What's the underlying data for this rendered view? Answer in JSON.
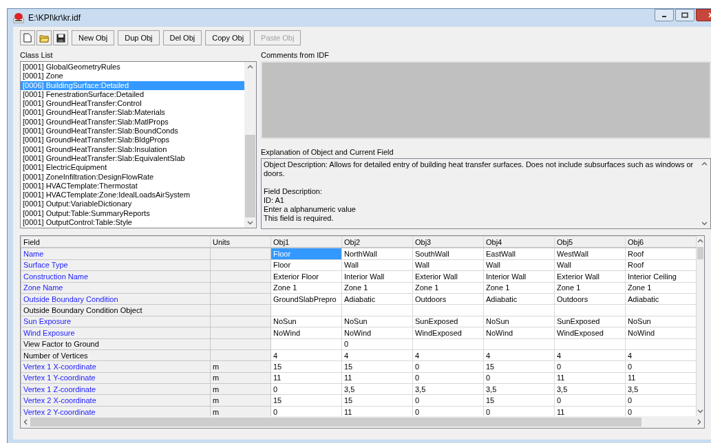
{
  "window": {
    "title": "E:\\KPI\\kr\\kr.idf"
  },
  "toolbar": {
    "buttons": [
      {
        "label": "New Obj",
        "disabled": false
      },
      {
        "label": "Dup Obj",
        "disabled": false
      },
      {
        "label": "Del Obj",
        "disabled": false
      },
      {
        "label": "Copy Obj",
        "disabled": false
      },
      {
        "label": "Paste Obj",
        "disabled": true
      }
    ]
  },
  "class_list": {
    "label": "Class List",
    "items": [
      {
        "text": "[0001]  GlobalGeometryRules",
        "selected": false
      },
      {
        "text": "[0001]  Zone",
        "selected": false
      },
      {
        "text": "[0006]  BuildingSurface:Detailed",
        "selected": true
      },
      {
        "text": "[0001]  FenestrationSurface:Detailed",
        "selected": false
      },
      {
        "text": "[0001]  GroundHeatTransfer:Control",
        "selected": false
      },
      {
        "text": "[0001]  GroundHeatTransfer:Slab:Materials",
        "selected": false
      },
      {
        "text": "[0001]  GroundHeatTransfer:Slab:MatlProps",
        "selected": false
      },
      {
        "text": "[0001]  GroundHeatTransfer:Slab:BoundConds",
        "selected": false
      },
      {
        "text": "[0001]  GroundHeatTransfer:Slab:BldgProps",
        "selected": false
      },
      {
        "text": "[0001]  GroundHeatTransfer:Slab:Insulation",
        "selected": false
      },
      {
        "text": "[0001]  GroundHeatTransfer:Slab:EquivalentSlab",
        "selected": false
      },
      {
        "text": "[0001]  ElectricEquipment",
        "selected": false
      },
      {
        "text": "[0001]  ZoneInfiltration:DesignFlowRate",
        "selected": false
      },
      {
        "text": "[0001]  HVACTemplate:Thermostat",
        "selected": false
      },
      {
        "text": "[0001]  HVACTemplate:Zone:IdealLoadsAirSystem",
        "selected": false
      },
      {
        "text": "[0001]  Output:VariableDictionary",
        "selected": false
      },
      {
        "text": "[0001]  Output:Table:SummaryReports",
        "selected": false
      },
      {
        "text": "[0001]  OutputControl:Table:Style",
        "selected": false
      }
    ]
  },
  "comments": {
    "label": "Comments from IDF"
  },
  "explanation": {
    "label": "Explanation of Object and Current Field",
    "lines": [
      "Object Description: Allows for detailed entry of building heat transfer surfaces.  Does not include subsurfaces such as windows or doors.",
      "Field Description:",
      "ID: A1",
      "Enter a alphanumeric value",
      "This field is required."
    ]
  },
  "grid": {
    "field_header": "Field",
    "units_header": "Units",
    "columns": [
      "Obj1",
      "Obj2",
      "Obj3",
      "Obj4",
      "Obj5",
      "Obj6"
    ],
    "rows": [
      {
        "field": "Name",
        "required": true,
        "cells": [
          {
            "text": "Floor",
            "selected": true
          },
          {
            "text": "NorthWall",
            "selected": false
          },
          {
            "text": "SouthWall",
            "selected": false
          },
          {
            "text": "EastWall",
            "selected": false
          },
          {
            "text": "WestWall",
            "selected": false
          },
          {
            "text": "Roof",
            "selected": false
          }
        ]
      },
      {
        "field": "Surface Type",
        "required": true,
        "cells": [
          {
            "text": "Floor",
            "selected": false
          },
          {
            "text": "Wall",
            "selected": false
          },
          {
            "text": "Wall",
            "selected": false
          },
          {
            "text": "Wall",
            "selected": false
          },
          {
            "text": "Wall",
            "selected": false
          },
          {
            "text": "Roof",
            "selected": false
          }
        ]
      },
      {
        "field": "Construction Name",
        "required": true,
        "cells": [
          {
            "text": "Exterior Floor",
            "selected": false
          },
          {
            "text": "Interior Wall",
            "selected": false
          },
          {
            "text": "Exterior Wall",
            "selected": false
          },
          {
            "text": "Interior Wall",
            "selected": false
          },
          {
            "text": "Exterior Wall",
            "selected": false
          },
          {
            "text": "Interior Ceiling",
            "selected": false
          }
        ]
      },
      {
        "field": "Zone Name",
        "required": true,
        "cells": [
          {
            "text": "Zone 1",
            "selected": false
          },
          {
            "text": "Zone 1",
            "selected": false
          },
          {
            "text": "Zone 1",
            "selected": false
          },
          {
            "text": "Zone 1",
            "selected": false
          },
          {
            "text": "Zone 1",
            "selected": false
          },
          {
            "text": "Zone 1",
            "selected": false
          }
        ]
      },
      {
        "field": "Outside Boundary Condition",
        "required": true,
        "cells": [
          {
            "text": "GroundSlabPrepro",
            "selected": false
          },
          {
            "text": "Adiabatic",
            "selected": false
          },
          {
            "text": "Outdoors",
            "selected": false
          },
          {
            "text": "Adiabatic",
            "selected": false
          },
          {
            "text": "Outdoors",
            "selected": false
          },
          {
            "text": "Adiabatic",
            "selected": false
          }
        ]
      },
      {
        "field": "Outside Boundary Condition Object",
        "required": false,
        "cells": [
          {
            "selected": false
          },
          {
            "selected": false
          },
          {
            "selected": false
          },
          {
            "selected": false
          },
          {
            "selected": false
          },
          {
            "selected": false
          }
        ]
      },
      {
        "field": "Sun Exposure",
        "required": true,
        "cells": [
          {
            "text": "NoSun",
            "selected": false
          },
          {
            "text": "NoSun",
            "selected": false
          },
          {
            "text": "SunExposed",
            "selected": false
          },
          {
            "text": "NoSun",
            "selected": false
          },
          {
            "text": "SunExposed",
            "selected": false
          },
          {
            "text": "NoSun",
            "selected": false
          }
        ]
      },
      {
        "field": "Wind Exposure",
        "required": true,
        "cells": [
          {
            "text": "NoWind",
            "selected": false
          },
          {
            "text": "NoWind",
            "selected": false
          },
          {
            "text": "WindExposed",
            "selected": false
          },
          {
            "text": "NoWind",
            "selected": false
          },
          {
            "text": "WindExposed",
            "selected": false
          },
          {
            "text": "NoWind",
            "selected": false
          }
        ]
      },
      {
        "field": "View Factor to Ground",
        "required": false,
        "cells": [
          {
            "selected": false
          },
          {
            "text": "0",
            "selected": false
          },
          {
            "selected": false
          },
          {
            "selected": false
          },
          {
            "selected": false
          },
          {
            "selected": false
          }
        ]
      },
      {
        "field": "Number of Vertices",
        "required": false,
        "cells": [
          {
            "text": "4",
            "selected": false
          },
          {
            "text": "4",
            "selected": false
          },
          {
            "text": "4",
            "selected": false
          },
          {
            "text": "4",
            "selected": false
          },
          {
            "text": "4",
            "selected": false
          },
          {
            "text": "4",
            "selected": false
          }
        ]
      },
      {
        "field": "Vertex 1 X-coordinate",
        "required": true,
        "units": "m",
        "cells": [
          {
            "text": "15",
            "selected": false
          },
          {
            "text": "15",
            "selected": false
          },
          {
            "text": "0",
            "selected": false
          },
          {
            "text": "15",
            "selected": false
          },
          {
            "text": "0",
            "selected": false
          },
          {
            "text": "0",
            "selected": false
          }
        ]
      },
      {
        "field": "Vertex 1 Y-coordinate",
        "required": true,
        "units": "m",
        "cells": [
          {
            "text": "11",
            "selected": false
          },
          {
            "text": "11",
            "selected": false
          },
          {
            "text": "0",
            "selected": false
          },
          {
            "text": "0",
            "selected": false
          },
          {
            "text": "11",
            "selected": false
          },
          {
            "text": "11",
            "selected": false
          }
        ]
      },
      {
        "field": "Vertex 1 Z-coordinate",
        "required": true,
        "units": "m",
        "cells": [
          {
            "text": "0",
            "selected": false
          },
          {
            "text": "3,5",
            "selected": false
          },
          {
            "text": "3,5",
            "selected": false
          },
          {
            "text": "3,5",
            "selected": false
          },
          {
            "text": "3,5",
            "selected": false
          },
          {
            "text": "3,5",
            "selected": false
          }
        ]
      },
      {
        "field": "Vertex 2 X-coordinate",
        "required": true,
        "units": "m",
        "cells": [
          {
            "text": "15",
            "selected": false
          },
          {
            "text": "15",
            "selected": false
          },
          {
            "text": "0",
            "selected": false
          },
          {
            "text": "15",
            "selected": false
          },
          {
            "text": "0",
            "selected": false
          },
          {
            "text": "0",
            "selected": false
          }
        ]
      },
      {
        "field": "Vertex 2 Y-coordinate",
        "required": true,
        "units": "m",
        "cells": [
          {
            "text": "0",
            "selected": false
          },
          {
            "text": "11",
            "selected": false
          },
          {
            "text": "0",
            "selected": false
          },
          {
            "text": "0",
            "selected": false
          },
          {
            "text": "11",
            "selected": false
          },
          {
            "text": "0",
            "selected": false
          }
        ]
      }
    ]
  }
}
